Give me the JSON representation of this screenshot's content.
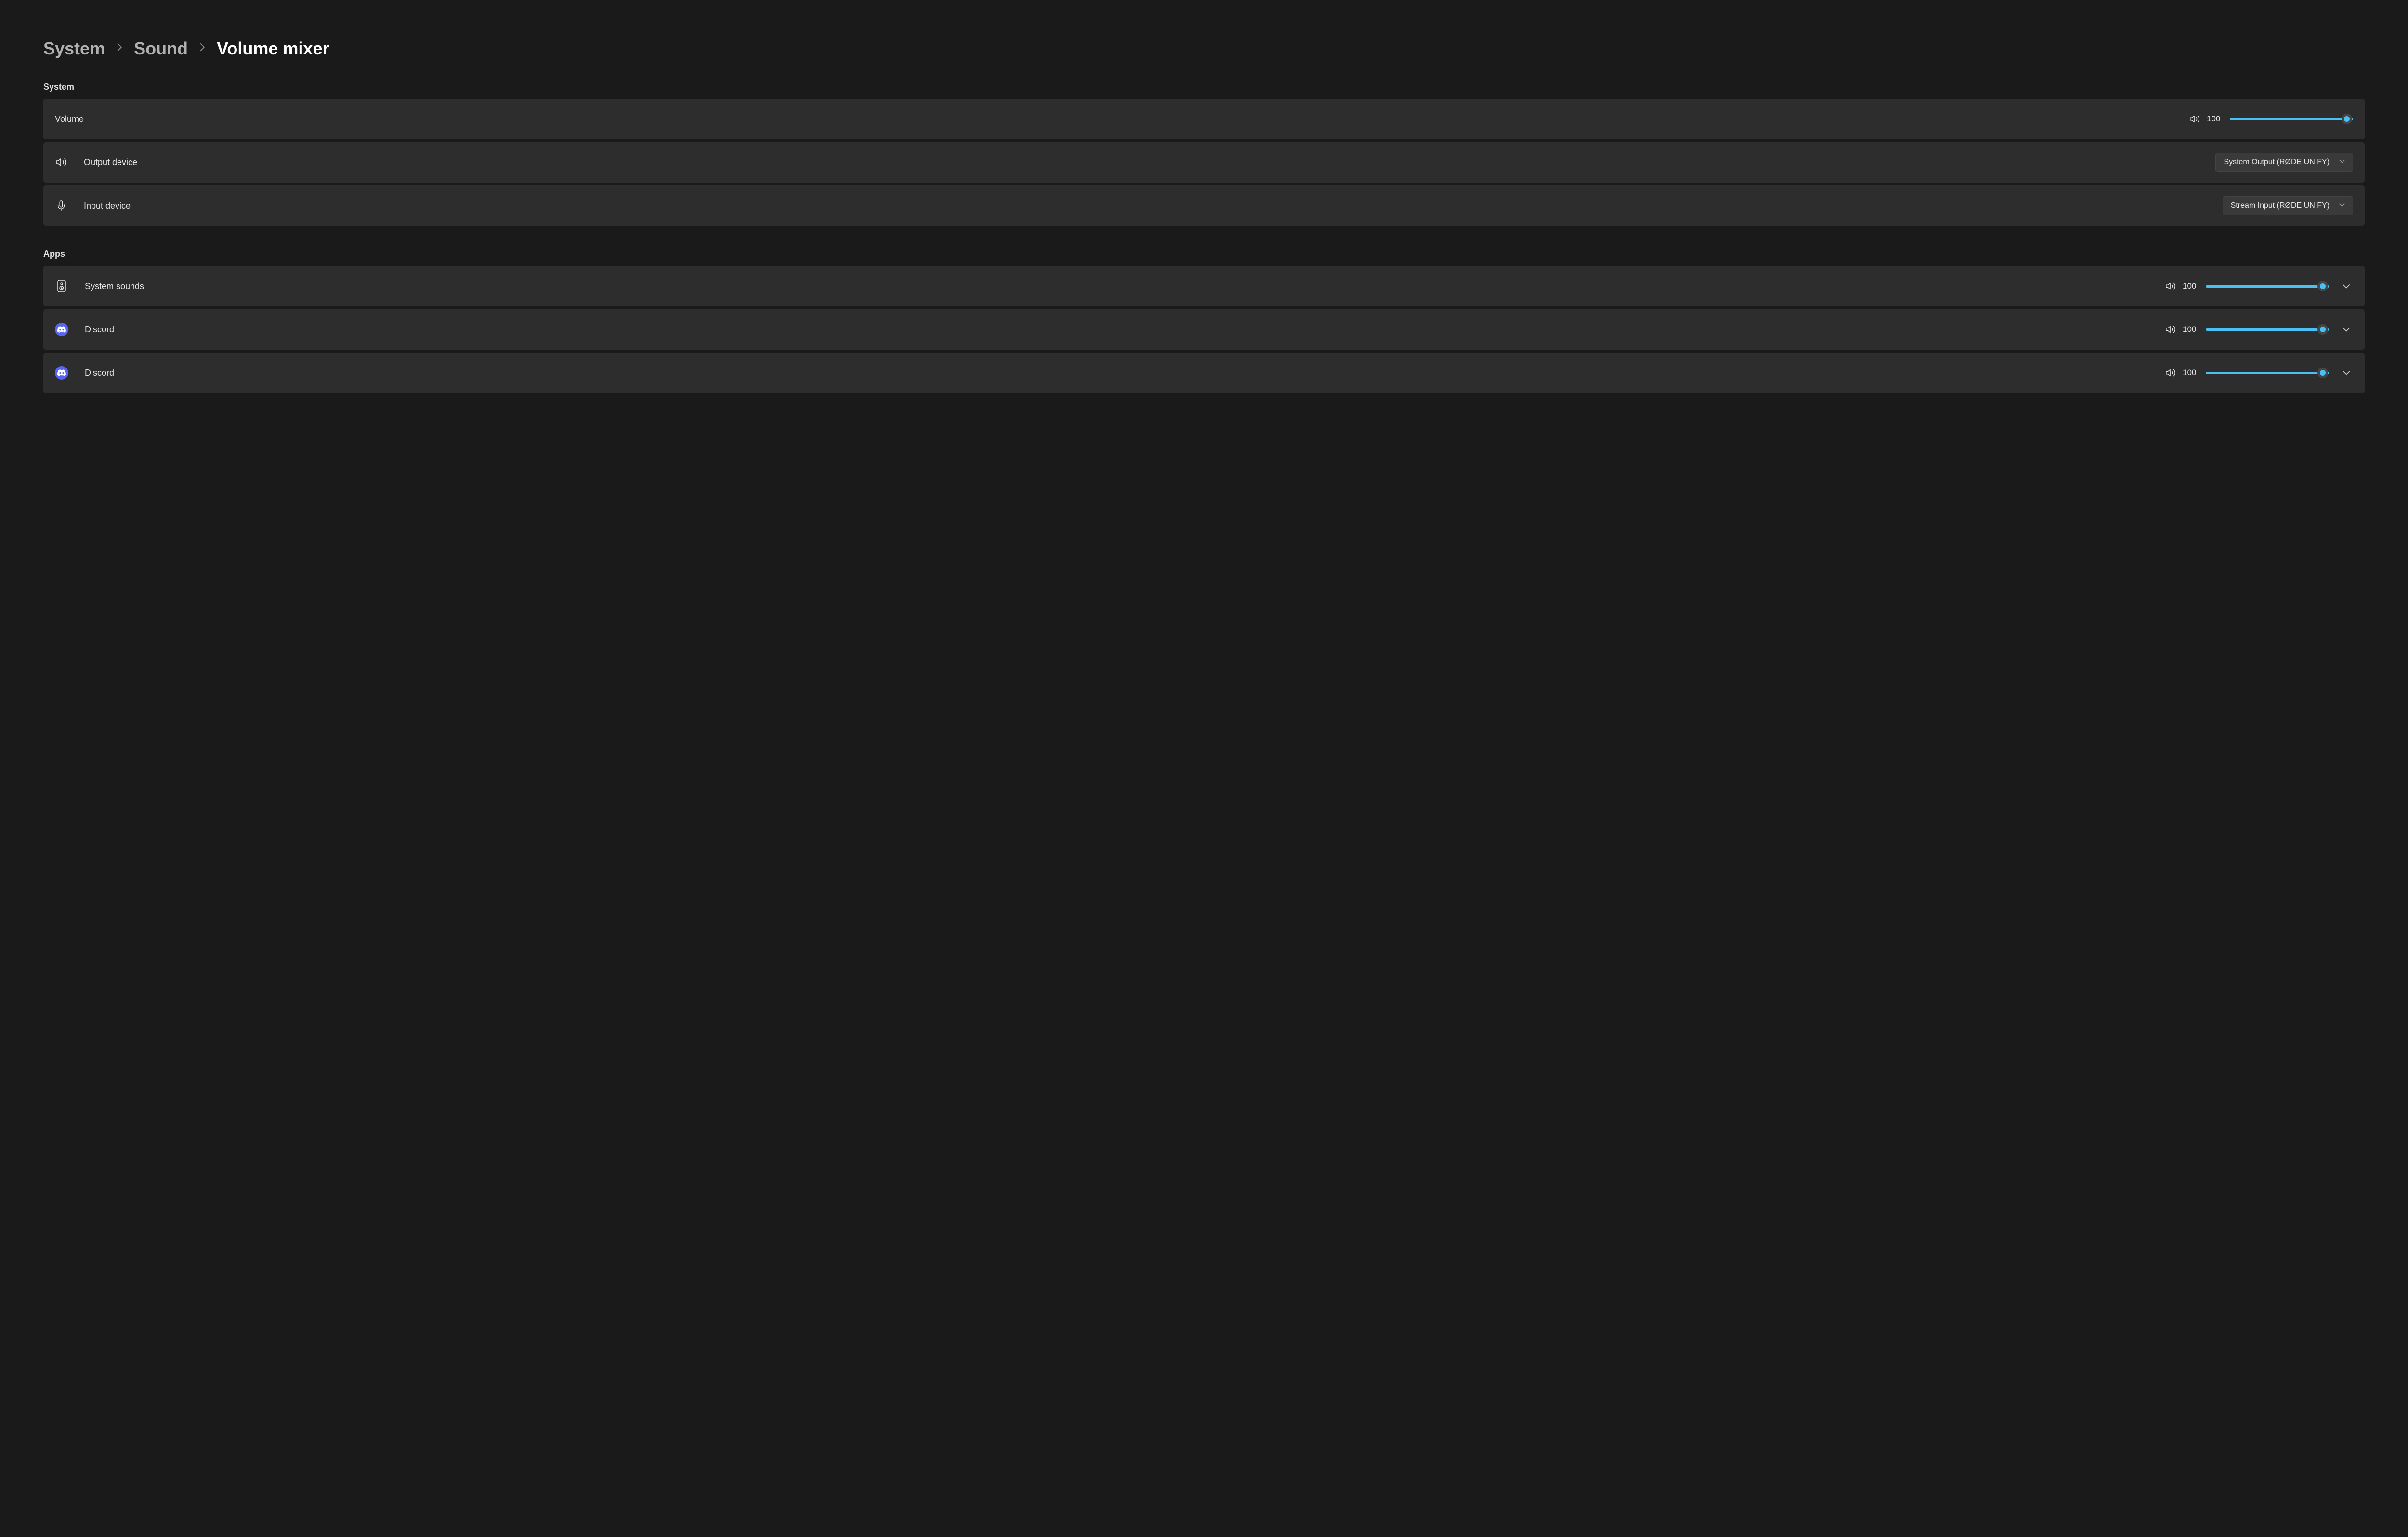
{
  "breadcrumb": {
    "system": "System",
    "sound": "Sound",
    "current": "Volume mixer"
  },
  "sections": {
    "system": {
      "header": "System",
      "volume": {
        "label": "Volume",
        "value": "100"
      },
      "output": {
        "label": "Output device",
        "selected": "System Output (RØDE UNIFY)"
      },
      "input": {
        "label": "Input device",
        "selected": "Stream Input (RØDE UNIFY)"
      }
    },
    "apps": {
      "header": "Apps",
      "items": [
        {
          "label": "System sounds",
          "value": "100",
          "icon": "speaker"
        },
        {
          "label": "Discord",
          "value": "100",
          "icon": "discord"
        },
        {
          "label": "Discord",
          "value": "100",
          "icon": "discord"
        }
      ]
    }
  }
}
